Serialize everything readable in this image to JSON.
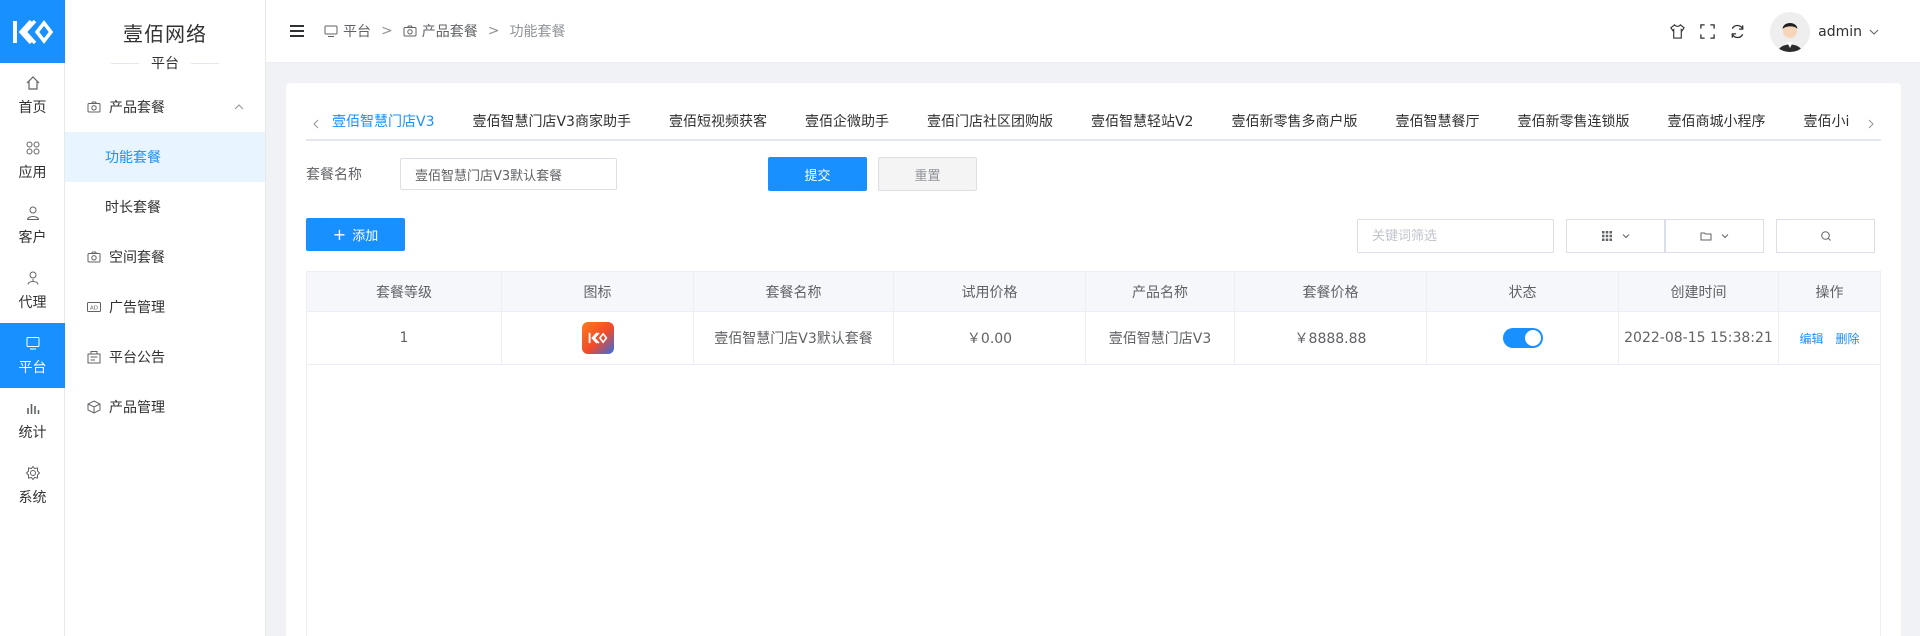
{
  "rail": {
    "items": [
      {
        "label": "首页",
        "icon": "home-icon"
      },
      {
        "label": "应用",
        "icon": "apps-icon"
      },
      {
        "label": "客户",
        "icon": "user-icon"
      },
      {
        "label": "代理",
        "icon": "agent-icon"
      },
      {
        "label": "平台",
        "icon": "monitor-icon"
      },
      {
        "label": "统计",
        "icon": "bar-chart-icon"
      },
      {
        "label": "系统",
        "icon": "gear-icon"
      }
    ],
    "active_index": 4
  },
  "brand": {
    "title": "壹佰网络",
    "subtitle": "平台"
  },
  "submenu": {
    "items": [
      {
        "label": "产品套餐",
        "icon": "camera-icon"
      },
      {
        "label": "功能套餐"
      },
      {
        "label": "时长套餐"
      },
      {
        "label": "空间套餐",
        "icon": "camera-icon"
      },
      {
        "label": "广告管理",
        "icon": "ad-icon"
      },
      {
        "label": "平台公告",
        "icon": "notice-icon"
      },
      {
        "label": "产品管理",
        "icon": "box-icon"
      }
    ]
  },
  "breadcrumb": {
    "items": [
      "平台",
      "产品套餐",
      "功能套餐"
    ],
    "sep": ">"
  },
  "user": {
    "name": "admin"
  },
  "tabs": [
    "壹佰智慧门店V3",
    "壹佰智慧门店V3商家助手",
    "壹佰短视频获客",
    "壹佰企微助手",
    "壹佰门店社区团购版",
    "壹佰智慧轻站V2",
    "壹佰新零售多商户版",
    "壹佰智慧餐厅",
    "壹佰新零售连锁版",
    "壹佰商城小程序",
    "壹佰小i"
  ],
  "search_form": {
    "label": "套餐名称",
    "value": "壹佰智慧门店V3默认套餐",
    "submit": "提交",
    "reset": "重置"
  },
  "toolbar": {
    "add": "添加",
    "keyword_placeholder": "关键词筛选"
  },
  "table": {
    "headers": [
      "套餐等级",
      "图标",
      "套餐名称",
      "试用价格",
      "产品名称",
      "套餐价格",
      "状态",
      "创建时间",
      "操作"
    ],
    "rows": [
      {
        "level": "1",
        "name": "壹佰智慧门店V3默认套餐",
        "trial_price": "￥0.00",
        "product": "壹佰智慧门店V3",
        "price": "￥8888.88",
        "status_on": true,
        "created": "2022-08-15 15:38:21",
        "ops": [
          "编辑",
          "删除"
        ]
      }
    ]
  },
  "colors": {
    "accent": "#1890ff"
  }
}
